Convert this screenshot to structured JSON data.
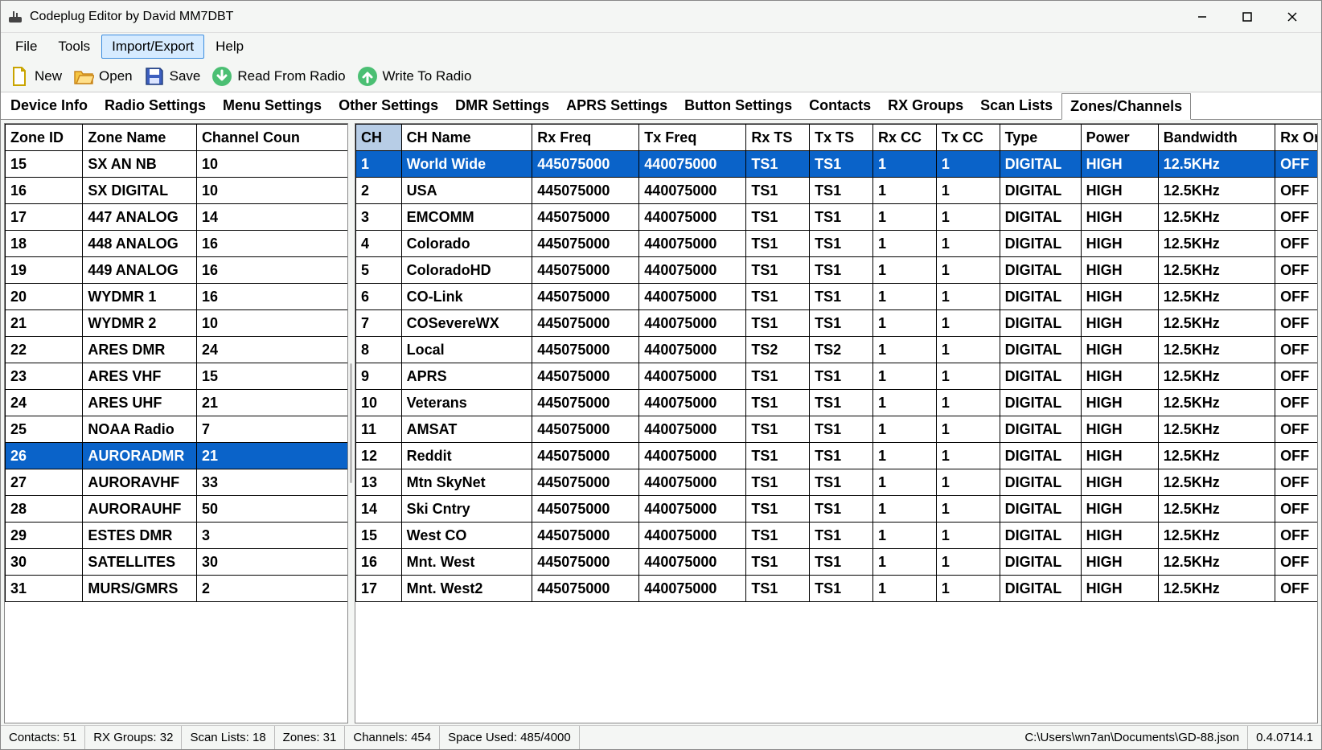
{
  "window": {
    "title": "Codeplug Editor by David MM7DBT"
  },
  "menu": {
    "file": "File",
    "tools": "Tools",
    "import_export": "Import/Export",
    "help": "Help"
  },
  "toolbar": {
    "new": "New",
    "open": "Open",
    "save": "Save",
    "read": "Read From Radio",
    "write": "Write To Radio"
  },
  "tabs": {
    "device_info": "Device Info",
    "radio_settings": "Radio Settings",
    "menu_settings": "Menu Settings",
    "other_settings": "Other Settings",
    "dmr_settings": "DMR Settings",
    "aprs_settings": "APRS Settings",
    "button_settings": "Button Settings",
    "contacts": "Contacts",
    "rx_groups": "RX Groups",
    "scan_lists": "Scan Lists",
    "zones_channels": "Zones/Channels"
  },
  "zone_headers": {
    "id": "Zone ID",
    "name": "Zone Name",
    "count": "Channel Coun"
  },
  "zones": [
    {
      "id": "15",
      "name": "SX AN NB",
      "count": "10"
    },
    {
      "id": "16",
      "name": "SX DIGITAL",
      "count": "10"
    },
    {
      "id": "17",
      "name": "447 ANALOG",
      "count": "14"
    },
    {
      "id": "18",
      "name": "448 ANALOG",
      "count": "16"
    },
    {
      "id": "19",
      "name": "449 ANALOG",
      "count": "16"
    },
    {
      "id": "20",
      "name": "WYDMR 1",
      "count": "16"
    },
    {
      "id": "21",
      "name": "WYDMR 2",
      "count": "10"
    },
    {
      "id": "22",
      "name": "ARES DMR",
      "count": "24"
    },
    {
      "id": "23",
      "name": "ARES VHF",
      "count": "15"
    },
    {
      "id": "24",
      "name": "ARES UHF",
      "count": "21"
    },
    {
      "id": "25",
      "name": "NOAA Radio",
      "count": "7"
    },
    {
      "id": "26",
      "name": "AURORADMR",
      "count": "21"
    },
    {
      "id": "27",
      "name": "AURORAVHF",
      "count": "33"
    },
    {
      "id": "28",
      "name": "AURORAUHF",
      "count": "50"
    },
    {
      "id": "29",
      "name": "ESTES DMR",
      "count": "3"
    },
    {
      "id": "30",
      "name": "SATELLITES",
      "count": "30"
    },
    {
      "id": "31",
      "name": "MURS/GMRS",
      "count": "2"
    }
  ],
  "zone_selected_index": 11,
  "channel_headers": {
    "ch": "CH",
    "name": "CH Name",
    "rxfreq": "Rx Freq",
    "txfreq": "Tx Freq",
    "rxts": "Rx TS",
    "txts": "Tx TS",
    "rxcc": "Rx CC",
    "txcc": "Tx CC",
    "type": "Type",
    "power": "Power",
    "bandwidth": "Bandwidth",
    "rxonly": "Rx Only"
  },
  "channels": [
    {
      "ch": "1",
      "name": "World Wide",
      "rx": "445075000",
      "tx": "440075000",
      "rxts": "TS1",
      "txts": "TS1",
      "rxcc": "1",
      "txcc": "1",
      "type": "DIGITAL",
      "power": "HIGH",
      "bw": "12.5KHz",
      "rxonly": "OFF"
    },
    {
      "ch": "2",
      "name": "USA",
      "rx": "445075000",
      "tx": "440075000",
      "rxts": "TS1",
      "txts": "TS1",
      "rxcc": "1",
      "txcc": "1",
      "type": "DIGITAL",
      "power": "HIGH",
      "bw": "12.5KHz",
      "rxonly": "OFF"
    },
    {
      "ch": "3",
      "name": "EMCOMM",
      "rx": "445075000",
      "tx": "440075000",
      "rxts": "TS1",
      "txts": "TS1",
      "rxcc": "1",
      "txcc": "1",
      "type": "DIGITAL",
      "power": "HIGH",
      "bw": "12.5KHz",
      "rxonly": "OFF"
    },
    {
      "ch": "4",
      "name": "Colorado",
      "rx": "445075000",
      "tx": "440075000",
      "rxts": "TS1",
      "txts": "TS1",
      "rxcc": "1",
      "txcc": "1",
      "type": "DIGITAL",
      "power": "HIGH",
      "bw": "12.5KHz",
      "rxonly": "OFF"
    },
    {
      "ch": "5",
      "name": "ColoradoHD",
      "rx": "445075000",
      "tx": "440075000",
      "rxts": "TS1",
      "txts": "TS1",
      "rxcc": "1",
      "txcc": "1",
      "type": "DIGITAL",
      "power": "HIGH",
      "bw": "12.5KHz",
      "rxonly": "OFF"
    },
    {
      "ch": "6",
      "name": "CO-Link",
      "rx": "445075000",
      "tx": "440075000",
      "rxts": "TS1",
      "txts": "TS1",
      "rxcc": "1",
      "txcc": "1",
      "type": "DIGITAL",
      "power": "HIGH",
      "bw": "12.5KHz",
      "rxonly": "OFF"
    },
    {
      "ch": "7",
      "name": "COSevereWX",
      "rx": "445075000",
      "tx": "440075000",
      "rxts": "TS1",
      "txts": "TS1",
      "rxcc": "1",
      "txcc": "1",
      "type": "DIGITAL",
      "power": "HIGH",
      "bw": "12.5KHz",
      "rxonly": "OFF"
    },
    {
      "ch": "8",
      "name": "Local",
      "rx": "445075000",
      "tx": "440075000",
      "rxts": "TS2",
      "txts": "TS2",
      "rxcc": "1",
      "txcc": "1",
      "type": "DIGITAL",
      "power": "HIGH",
      "bw": "12.5KHz",
      "rxonly": "OFF"
    },
    {
      "ch": "9",
      "name": "APRS",
      "rx": "445075000",
      "tx": "440075000",
      "rxts": "TS1",
      "txts": "TS1",
      "rxcc": "1",
      "txcc": "1",
      "type": "DIGITAL",
      "power": "HIGH",
      "bw": "12.5KHz",
      "rxonly": "OFF"
    },
    {
      "ch": "10",
      "name": "Veterans",
      "rx": "445075000",
      "tx": "440075000",
      "rxts": "TS1",
      "txts": "TS1",
      "rxcc": "1",
      "txcc": "1",
      "type": "DIGITAL",
      "power": "HIGH",
      "bw": "12.5KHz",
      "rxonly": "OFF"
    },
    {
      "ch": "11",
      "name": "AMSAT",
      "rx": "445075000",
      "tx": "440075000",
      "rxts": "TS1",
      "txts": "TS1",
      "rxcc": "1",
      "txcc": "1",
      "type": "DIGITAL",
      "power": "HIGH",
      "bw": "12.5KHz",
      "rxonly": "OFF"
    },
    {
      "ch": "12",
      "name": "Reddit",
      "rx": "445075000",
      "tx": "440075000",
      "rxts": "TS1",
      "txts": "TS1",
      "rxcc": "1",
      "txcc": "1",
      "type": "DIGITAL",
      "power": "HIGH",
      "bw": "12.5KHz",
      "rxonly": "OFF"
    },
    {
      "ch": "13",
      "name": "Mtn SkyNet",
      "rx": "445075000",
      "tx": "440075000",
      "rxts": "TS1",
      "txts": "TS1",
      "rxcc": "1",
      "txcc": "1",
      "type": "DIGITAL",
      "power": "HIGH",
      "bw": "12.5KHz",
      "rxonly": "OFF"
    },
    {
      "ch": "14",
      "name": "Ski Cntry",
      "rx": "445075000",
      "tx": "440075000",
      "rxts": "TS1",
      "txts": "TS1",
      "rxcc": "1",
      "txcc": "1",
      "type": "DIGITAL",
      "power": "HIGH",
      "bw": "12.5KHz",
      "rxonly": "OFF"
    },
    {
      "ch": "15",
      "name": "West CO",
      "rx": "445075000",
      "tx": "440075000",
      "rxts": "TS1",
      "txts": "TS1",
      "rxcc": "1",
      "txcc": "1",
      "type": "DIGITAL",
      "power": "HIGH",
      "bw": "12.5KHz",
      "rxonly": "OFF"
    },
    {
      "ch": "16",
      "name": "Mnt. West",
      "rx": "445075000",
      "tx": "440075000",
      "rxts": "TS1",
      "txts": "TS1",
      "rxcc": "1",
      "txcc": "1",
      "type": "DIGITAL",
      "power": "HIGH",
      "bw": "12.5KHz",
      "rxonly": "OFF"
    },
    {
      "ch": "17",
      "name": "Mnt. West2",
      "rx": "445075000",
      "tx": "440075000",
      "rxts": "TS1",
      "txts": "TS1",
      "rxcc": "1",
      "txcc": "1",
      "type": "DIGITAL",
      "power": "HIGH",
      "bw": "12.5KHz",
      "rxonly": "OFF"
    }
  ],
  "channel_selected_index": 0,
  "status": {
    "contacts": "Contacts: 51",
    "rxgroups": "RX Groups: 32",
    "scanlists": "Scan Lists: 18",
    "zones": "Zones: 31",
    "channels": "Channels: 454",
    "space": "Space Used: 485/4000",
    "filepath": "C:\\Users\\wn7an\\Documents\\GD-88.json",
    "version": "0.4.0714.1"
  }
}
